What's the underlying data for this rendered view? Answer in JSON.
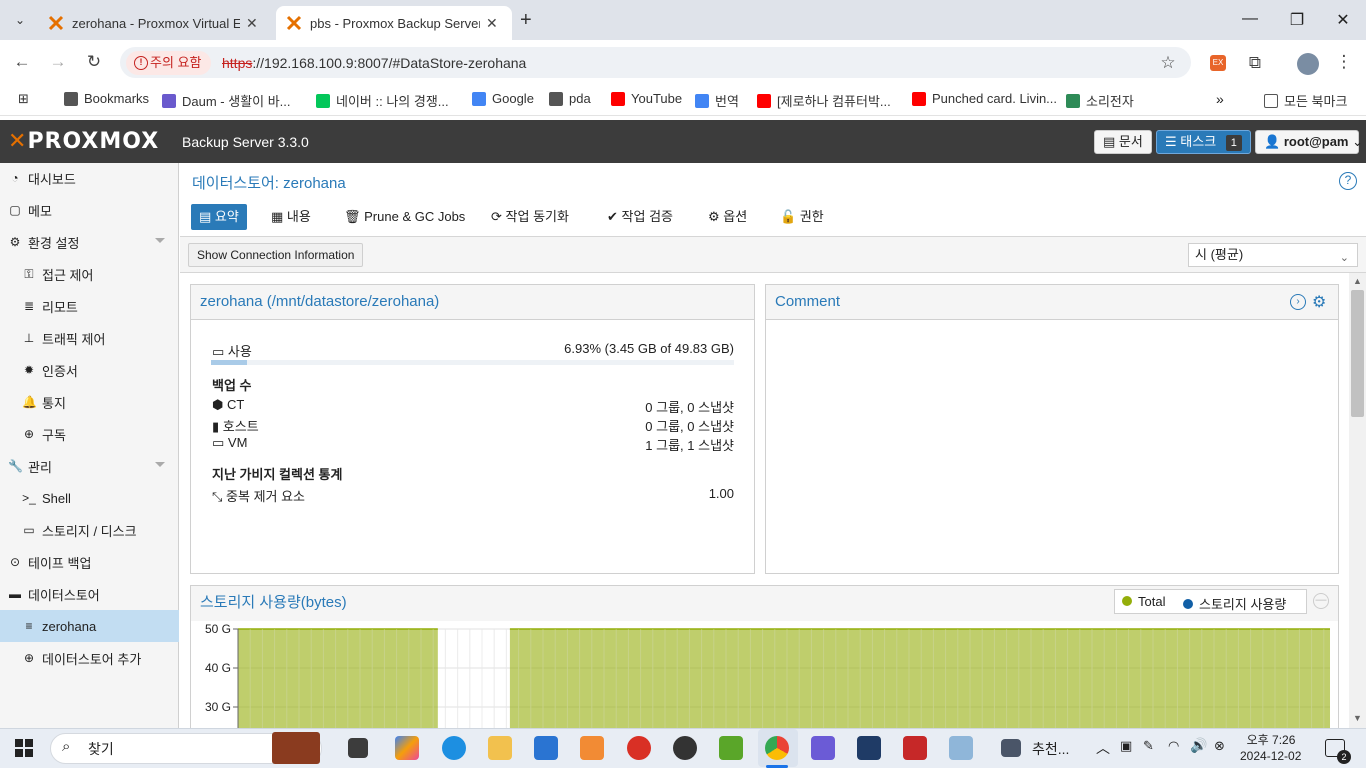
{
  "browser": {
    "tabs": [
      {
        "title": "zerohana - Proxmox Virtual En",
        "close": "✕"
      },
      {
        "title": "pbs - Proxmox Backup Server",
        "close": "✕"
      }
    ],
    "new_tab": "+",
    "security_badge": "주의 요함",
    "url_scheme": "https",
    "url_rest": "://192.168.100.9:8007/#DataStore-zerohana",
    "bookmarks": [
      {
        "label": "Bookmarks",
        "color": "#555555"
      },
      {
        "label": "Daum - 생활이 바...",
        "color": "#6a5acd"
      },
      {
        "label": "네이버 :: 나의 경쟁...",
        "color": "#03c75a"
      },
      {
        "label": "Google",
        "color": "#4285f4"
      },
      {
        "label": "pda",
        "color": "#555555"
      },
      {
        "label": "YouTube",
        "color": "#ff0000"
      },
      {
        "label": "번역",
        "color": "#4285f4"
      },
      {
        "label": "[제로하나 컴퓨터박...",
        "color": "#ff0000"
      },
      {
        "label": "Punched card. Livin...",
        "color": "#ff0000"
      },
      {
        "label": "소리전자",
        "color": "#2e8b57"
      }
    ],
    "all_bookmarks": "모든 북마크"
  },
  "header": {
    "logo": "PROXMOX",
    "product": "Backup Server 3.3.0",
    "docs_label": "문서",
    "tasks_label": "태스크",
    "tasks_count": "1",
    "user_label": "root@pam"
  },
  "sidebar": {
    "items": [
      {
        "label": "대시보드",
        "icon": "dashboard-icon"
      },
      {
        "label": "메모",
        "icon": "note-icon"
      },
      {
        "label": "환경 설정",
        "icon": "gears-icon"
      },
      {
        "label": "접근 제어",
        "icon": "key-icon"
      },
      {
        "label": "리모트",
        "icon": "server-icon"
      },
      {
        "label": "트래픽 제어",
        "icon": "traffic-icon"
      },
      {
        "label": "인증서",
        "icon": "certificate-icon"
      },
      {
        "label": "통지",
        "icon": "bell-icon"
      },
      {
        "label": "구독",
        "icon": "support-icon"
      },
      {
        "label": "관리",
        "icon": "wrench-icon"
      },
      {
        "label": "Shell",
        "icon": "terminal-icon"
      },
      {
        "label": "스토리지 / 디스크",
        "icon": "hdd-icon"
      },
      {
        "label": "테이프 백업",
        "icon": "tape-icon"
      },
      {
        "label": "데이터스토어",
        "icon": "archive-icon"
      },
      {
        "label": "zerohana",
        "icon": "database-icon"
      },
      {
        "label": "데이터스토어 추가",
        "icon": "plus-circle-icon"
      }
    ]
  },
  "content": {
    "title": "데이터스토어: zerohana",
    "tabs": [
      "요약",
      "내용",
      "Prune & GC Jobs",
      "작업 동기화",
      "작업 검증",
      "옵션",
      "권한"
    ],
    "connection_button": "Show Connection Information",
    "timeframe": "시 (평균)",
    "summary": {
      "title": "zerohana (/mnt/datastore/zerohana)",
      "usage_label": "사용",
      "usage_value": "6.93% (3.45 GB of 49.83 GB)",
      "usage_fraction": 0.0693,
      "backup_count_heading": "백업 수",
      "counts": [
        {
          "label": "CT",
          "value": "0 그룹, 0 스냅샷"
        },
        {
          "label": "호스트",
          "value": "0 그룹, 0 스냅샷"
        },
        {
          "label": "VM",
          "value": "1 그룹, 1 스냅샷"
        }
      ],
      "gc_heading": "지난 가비지 컬렉션 통계",
      "dedup_label": "중복 제거 요소",
      "dedup_value": "1.00"
    },
    "comment": {
      "title": "Comment"
    }
  },
  "chart_data": {
    "type": "area",
    "title": "스토리지 사용량(bytes)",
    "yticks": [
      "50 G",
      "40 G",
      "30 G"
    ],
    "ylim": [
      0,
      50
    ],
    "series": [
      {
        "name": "Total",
        "color": "#94ae0a",
        "segments": [
          {
            "start": 0,
            "end": 0.183,
            "value": 50
          },
          {
            "start": 0.249,
            "end": 1.0,
            "value": 50
          }
        ]
      },
      {
        "name": "스토리지 사용량",
        "color": "#115fa6",
        "segments": []
      }
    ]
  },
  "taskbar": {
    "search": "찾기",
    "app_label": "추천...",
    "time": "오후 7:26",
    "date": "2024-12-02",
    "notifications": "2"
  }
}
